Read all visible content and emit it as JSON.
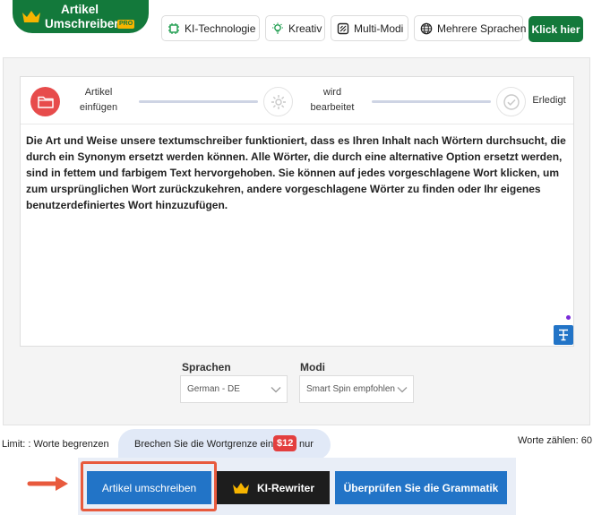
{
  "brand": {
    "title_line1": "Artikel",
    "title_line2": "Umschreiber",
    "badge": "PRO",
    "color": "#13793b",
    "icon": "crown-icon"
  },
  "features": [
    {
      "label": "KI-Technologie",
      "icon": "chip-icon"
    },
    {
      "label": "Kreativ",
      "icon": "lightbulb-icon"
    },
    {
      "label": "Multi-Modi",
      "icon": "layers-icon"
    },
    {
      "label": "Mehrere Sprachen",
      "icon": "globe-icon"
    }
  ],
  "cta_label": "Klick hier",
  "steps": [
    {
      "label_line1": "Artikel",
      "label_line2": "einfügen",
      "icon": "folder-icon",
      "state": "active"
    },
    {
      "label_line1": "wird",
      "label_line2": "bearbeitet",
      "icon": "gear-icon",
      "state": "pending"
    },
    {
      "label_line1": "Erledigt",
      "label_line2": "",
      "icon": "check-circle-icon",
      "state": "pending"
    }
  ],
  "editor": {
    "text": "Die Art und Weise unsere textumschreiber funktioniert, dass es Ihren Inhalt nach Wörtern durchsucht, die durch ein Synonym ersetzt werden können. Alle Wörter, die durch eine alternative Option ersetzt werden, sind in fettem und farbigem Text hervorgehoben. Sie können auf jedes vorgeschlagene Wort klicken, um zum ursprünglichen Wort zurückzukehren, andere vorgeschlagene Wörter zu finden oder Ihr eigenes benutzerdefiniertes Wort hinzuzufügen."
  },
  "selects": {
    "language_label": "Sprachen",
    "language_value": "German - DE",
    "mode_label": "Modi",
    "mode_value": "Smart Spin empfohlen"
  },
  "footer": {
    "limit_text": "Limit: : Worte begrenzen",
    "promo_text": "Brechen Sie die Wortgrenze ein",
    "promo_price": "$12",
    "promo_tail": "nur",
    "count_text": "Worte zählen: 60"
  },
  "actions": {
    "rewrite": "Artikel umschreiben",
    "ki_rewriter": "KI-Rewriter",
    "grammar": "Überprüfen Sie die Grammatik"
  },
  "colors": {
    "primary_blue": "#2274c7",
    "dark": "#1d1d1d",
    "promo_red": "#e33f3f",
    "highlight": "#e85a3d",
    "step_active": "#e74c4c"
  }
}
